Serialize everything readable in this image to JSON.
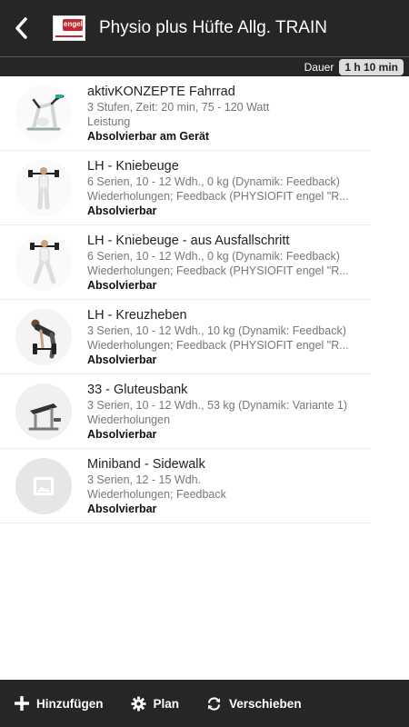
{
  "header": {
    "title": "Physio plus Hüfte Allg. TRAIN",
    "logo_text": "engel",
    "back_icon": "chevron-left-icon",
    "logo_icon": "physiofit-engel-logo"
  },
  "subbar": {
    "duration_label": "Dauer",
    "duration_value": "1 h 10 min"
  },
  "items": [
    {
      "name": "aktivKONZEPTE Fahrrad",
      "detail1": "3 Stufen, Zeit: 20 min, 75 - 120 Watt",
      "detail2": "Leistung",
      "status": "Absolvierbar am Gerät",
      "icon": "exercise-bike-image"
    },
    {
      "name": "LH - Kniebeuge",
      "detail1": "6 Serien, 10 - 12 Wdh., 0 kg (Dynamik: Feedback)",
      "detail2": "Wiederholungen; Feedback (PHYSIOFIT engel \"R...",
      "status": "Absolvierbar",
      "icon": "squat-image"
    },
    {
      "name": "LH - Kniebeuge - aus Ausfallschritt",
      "detail1": "6 Serien, 10 - 12 Wdh., 0 kg (Dynamik: Feedback)",
      "detail2": "Wiederholungen; Feedback (PHYSIOFIT engel \"R...",
      "status": "Absolvierbar",
      "icon": "lunge-squat-image"
    },
    {
      "name": "LH - Kreuzheben",
      "detail1": "3 Serien, 10 - 12 Wdh., 10 kg (Dynamik: Feedback)",
      "detail2": "Wiederholungen; Feedback (PHYSIOFIT engel \"R...",
      "status": "Absolvierbar",
      "icon": "deadlift-image"
    },
    {
      "name": "33 - Gluteusbank",
      "detail1": "3 Serien, 10 - 12 Wdh., 53 kg (Dynamik: Variante 1)",
      "detail2": "Wiederholungen",
      "status": "Absolvierbar",
      "icon": "glute-bench-image"
    },
    {
      "name": "Miniband - Sidewalk",
      "detail1": "3 Serien, 12 - 15 Wdh.",
      "detail2": "Wiederholungen; Feedback",
      "status": "Absolvierbar",
      "icon": "image-placeholder-icon"
    }
  ],
  "footer": {
    "add_label": "Hinzufügen",
    "plan_label": "Plan",
    "move_label": "Verschieben",
    "add_icon": "plus-icon",
    "plan_icon": "gear-icon",
    "move_icon": "refresh-icon"
  }
}
